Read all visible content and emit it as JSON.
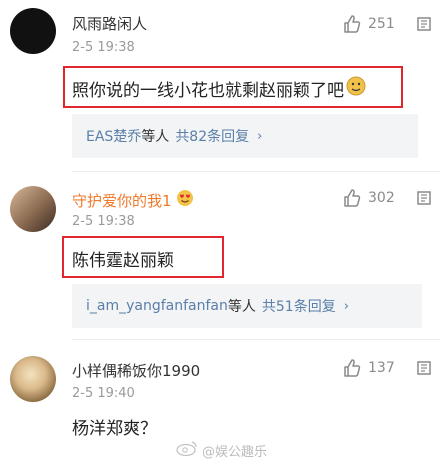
{
  "comments": [
    {
      "username": "风雨路闲人",
      "time": "2-5 19:38",
      "likes": "251",
      "text": "照你说的一线小花也就剩赵丽颖了吧",
      "emoji": "doge-emoji",
      "reply": {
        "users": "EAS楚乔",
        "suffix": "等人",
        "count": "共82条回复",
        "chevron": "›"
      }
    },
    {
      "username": "守护爱你的我1",
      "time": "2-5 19:38",
      "likes": "302",
      "text": "陈伟霆赵丽颖",
      "emoji": "heart-eyes-emoji",
      "reply": {
        "users": "i_am_yangfanfanfan",
        "suffix": "等人",
        "count": "共51条回复",
        "chevron": "›"
      }
    },
    {
      "username": "小样偶稀饭你1990",
      "time": "2-5 19:40",
      "likes": "137",
      "text": "杨洋郑爽？"
    }
  ],
  "watermark": "@娱公趣乐",
  "colors": {
    "highlight": "#e2262d",
    "link": "#5a7fa8",
    "username_vip": "#f07a2c"
  }
}
